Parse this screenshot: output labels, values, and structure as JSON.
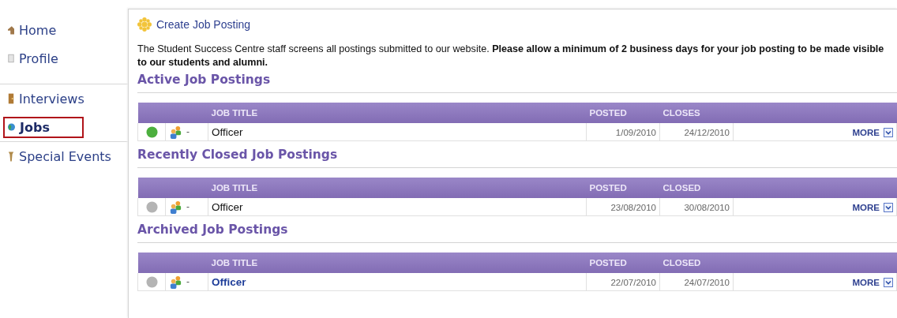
{
  "sidebar": {
    "items": [
      {
        "label": "Home",
        "kind": "house",
        "selected": false
      },
      {
        "label": "Profile",
        "kind": "page",
        "selected": false
      },
      {
        "label": "Interviews",
        "kind": "door",
        "selected": false
      },
      {
        "label": "Jobs",
        "kind": "globe",
        "selected": true
      },
      {
        "label": "Special Events",
        "kind": "pin",
        "selected": false
      }
    ]
  },
  "create_link": "Create Job Posting",
  "notice": "The Student Success Centre staff screens all postings submitted to our website. **Please allow a minimum of 2 business days for your job posting to be made visible to our students and alumni.**",
  "sections": [
    {
      "title": "Active Job Postings",
      "columns": [
        "JOB TITLE",
        "POSTED",
        "CLOSES"
      ],
      "rows": [
        {
          "color": "#4caf3e",
          "marker": "-",
          "title": "Officer",
          "linked": false,
          "posted": "1/09/2010",
          "closes": "24/12/2010",
          "more": "MORE"
        }
      ]
    },
    {
      "title": "Recently Closed Job Postings",
      "columns": [
        "JOB TITLE",
        "POSTED",
        "CLOSED"
      ],
      "rows": [
        {
          "color": "#b4b4b4",
          "marker": "-",
          "title": "Officer",
          "linked": false,
          "posted": "23/08/2010",
          "closes": "30/08/2010",
          "more": "MORE"
        }
      ]
    },
    {
      "title": "Archived Job Postings",
      "columns": [
        "JOB TITLE",
        "POSTED",
        "CLOSED"
      ],
      "rows": [
        {
          "color": "#b4b4b4",
          "marker": "-",
          "title": "Officer",
          "linked": true,
          "posted": "22/07/2010",
          "closes": "24/07/2010",
          "more": "MORE"
        }
      ]
    }
  ]
}
